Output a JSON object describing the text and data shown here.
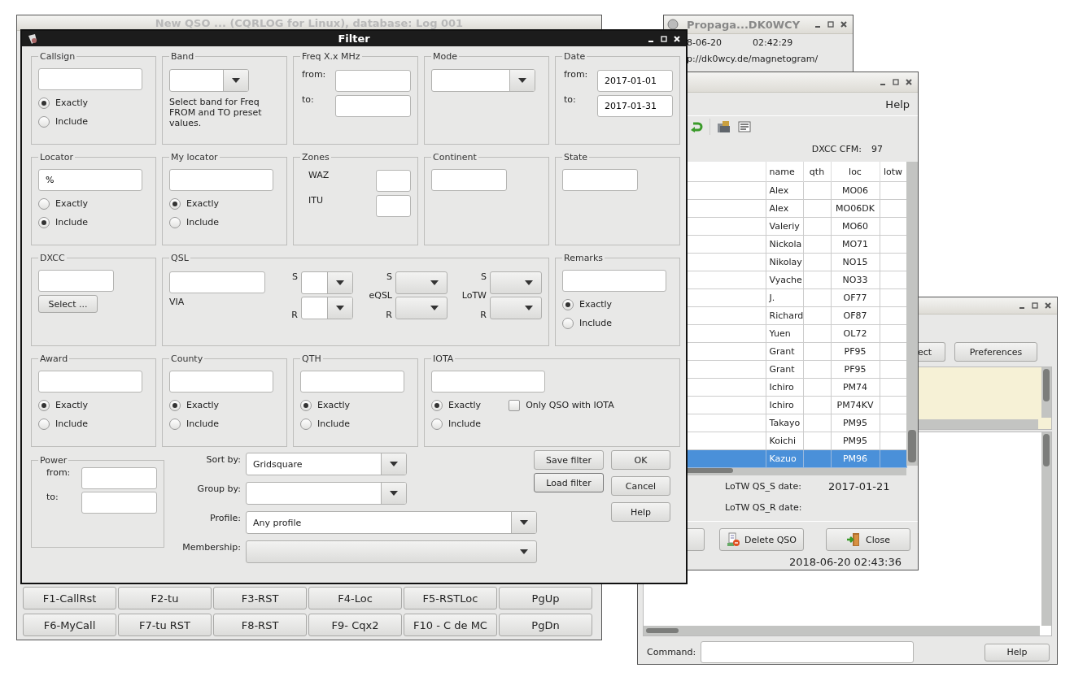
{
  "qso_window": {
    "title": "New QSO ... (CQRLOG for Linux), database: Log 001",
    "function_keys": [
      [
        "F1-CallRst",
        "F2-tu",
        "F3-RST",
        "F4-Loc",
        "F5-RSTLoc",
        "PgUp"
      ],
      [
        "F6-MyCall",
        "F7-tu RST",
        "F8-RST",
        "F9- Cqx2",
        "F10 - C de MC",
        "PgDn"
      ]
    ]
  },
  "propagation_window": {
    "title": "Propaga...DK0WCY",
    "date": "8-06-20",
    "time": "02:42:29",
    "url": "p://dk0wcy.de/magnetogram/"
  },
  "log_window": {
    "menu": [
      "Help"
    ],
    "dxcc_cfm_label": "DXCC CFM:",
    "dxcc_cfm": "97",
    "table": {
      "columns": [
        "name",
        "qth",
        "loc",
        "lotw"
      ],
      "rows": [
        {
          "name": "Alex",
          "loc": "MO06",
          "selected": false
        },
        {
          "name": "Alex",
          "loc": "MO06DK",
          "selected": false
        },
        {
          "name": "Valeriy",
          "loc": "MO60",
          "selected": false
        },
        {
          "name": "Nickola",
          "loc": "MO71",
          "selected": false
        },
        {
          "name": "Nikolay",
          "loc": "NO15",
          "selected": false
        },
        {
          "name": "Vyache",
          "loc": "NO33",
          "selected": false
        },
        {
          "name": "J.",
          "loc": "OF77",
          "selected": false
        },
        {
          "name": "Richard",
          "loc": "OF87",
          "selected": false
        },
        {
          "name": "Yuen",
          "loc": "OL72",
          "selected": false
        },
        {
          "name": "Grant",
          "loc": "PF95",
          "selected": false
        },
        {
          "name": "Grant",
          "loc": "PF95",
          "selected": false
        },
        {
          "name": "Ichiro",
          "loc": "PM74",
          "selected": false
        },
        {
          "name": "Ichiro",
          "loc": "PM74KV",
          "selected": false
        },
        {
          "name": "Takayo",
          "loc": "PM95",
          "selected": false
        },
        {
          "name": "Koichi",
          "loc": "PM95",
          "selected": false
        },
        {
          "name": "Kazuo",
          "loc": "PM96",
          "selected": true
        }
      ]
    },
    "lotw_qs_s_label": "LoTW QS_S date:",
    "lotw_qs_s_date": "2017-01-21",
    "lotw_qs_r_label": "LoTW QS_R date:",
    "buttons": [
      {
        "kind": "delete",
        "label": "Delete QSO"
      },
      {
        "kind": "close",
        "label": "Close"
      }
    ],
    "status": "2018-06-20  02:43:36"
  },
  "console_window": {
    "buttons": [
      "ect",
      "Preferences"
    ],
    "command_label": "Command:",
    "help_button": "Help"
  },
  "filter": {
    "title": "Filter",
    "groups": [
      {
        "kind": "text_match",
        "legend": "Callsign",
        "options": [
          {
            "label": "Exactly",
            "selected": true
          },
          {
            "label": "Include",
            "selected": false
          }
        ]
      },
      {
        "kind": "band",
        "legend": "Band",
        "hint": "Select band for Freq FROM and TO preset values."
      },
      {
        "kind": "range",
        "legend": "Freq  X.x MHz",
        "from_label": "from:",
        "to_label": "to:"
      },
      {
        "kind": "combo",
        "legend": "Mode"
      },
      {
        "kind": "range",
        "legend": "Date",
        "from_label": "from:",
        "to_label": "to:",
        "from": "2017-01-01",
        "to": "2017-01-31"
      },
      {
        "kind": "text_match",
        "legend": "Locator",
        "value": "%",
        "options": [
          {
            "label": "Exactly",
            "selected": false
          },
          {
            "label": "Include",
            "selected": true
          }
        ]
      },
      {
        "kind": "text_match",
        "legend": "My locator",
        "options": [
          {
            "label": "Exactly",
            "selected": true
          },
          {
            "label": "Include",
            "selected": false
          }
        ]
      },
      {
        "kind": "zones",
        "legend": "Zones",
        "labels": [
          "WAZ",
          "ITU"
        ]
      },
      {
        "kind": "text",
        "legend": "Continent"
      },
      {
        "kind": "text",
        "legend": "State"
      },
      {
        "kind": "dxcc",
        "legend": "DXCC",
        "button": "Select ..."
      },
      {
        "kind": "qsl",
        "legend": "QSL",
        "via_label": "VIA",
        "columns": [
          {
            "top": "S",
            "bottom": "R",
            "editable": true
          },
          {
            "top": "S",
            "middle": "eQSL",
            "bottom": "R",
            "editable": false
          },
          {
            "top": "S",
            "middle": "LoTW",
            "bottom": "R",
            "editable": false
          }
        ]
      },
      {
        "kind": "text_match",
        "legend": "Remarks",
        "options": [
          {
            "label": "Exactly",
            "selected": true
          },
          {
            "label": "Include",
            "selected": false
          }
        ]
      },
      {
        "kind": "text_match",
        "legend": "Award",
        "options": [
          {
            "label": "Exactly",
            "selected": true
          },
          {
            "label": "Include",
            "selected": false
          }
        ]
      },
      {
        "kind": "text_match",
        "legend": "County",
        "options": [
          {
            "label": "Exactly",
            "selected": true
          },
          {
            "label": "Include",
            "selected": false
          }
        ]
      },
      {
        "kind": "text_match",
        "legend": "QTH",
        "options": [
          {
            "label": "Exactly",
            "selected": true
          },
          {
            "label": "Include",
            "selected": false
          }
        ]
      },
      {
        "kind": "iota",
        "legend": "IOTA",
        "options": [
          {
            "label": "Exactly",
            "selected": true
          },
          {
            "label": "Include",
            "selected": false
          }
        ],
        "check": {
          "label": "Only QSO with IOTA",
          "checked": false
        }
      }
    ],
    "power": {
      "legend": "Power",
      "from_label": "from:",
      "to_label": "to:"
    },
    "selectors": [
      {
        "kind": "combo",
        "label": "Sort by:",
        "value": "Gridsquare"
      },
      {
        "kind": "combo",
        "label": "Group by:"
      },
      {
        "kind": "combo_wide",
        "label": "Profile:",
        "value": "Any profile"
      },
      {
        "kind": "dropdown",
        "label": "Membership:"
      }
    ],
    "filter_buttons": [
      "Save filter",
      "Load filter"
    ],
    "dialog_buttons": [
      "OK",
      "Cancel",
      "Help"
    ]
  }
}
